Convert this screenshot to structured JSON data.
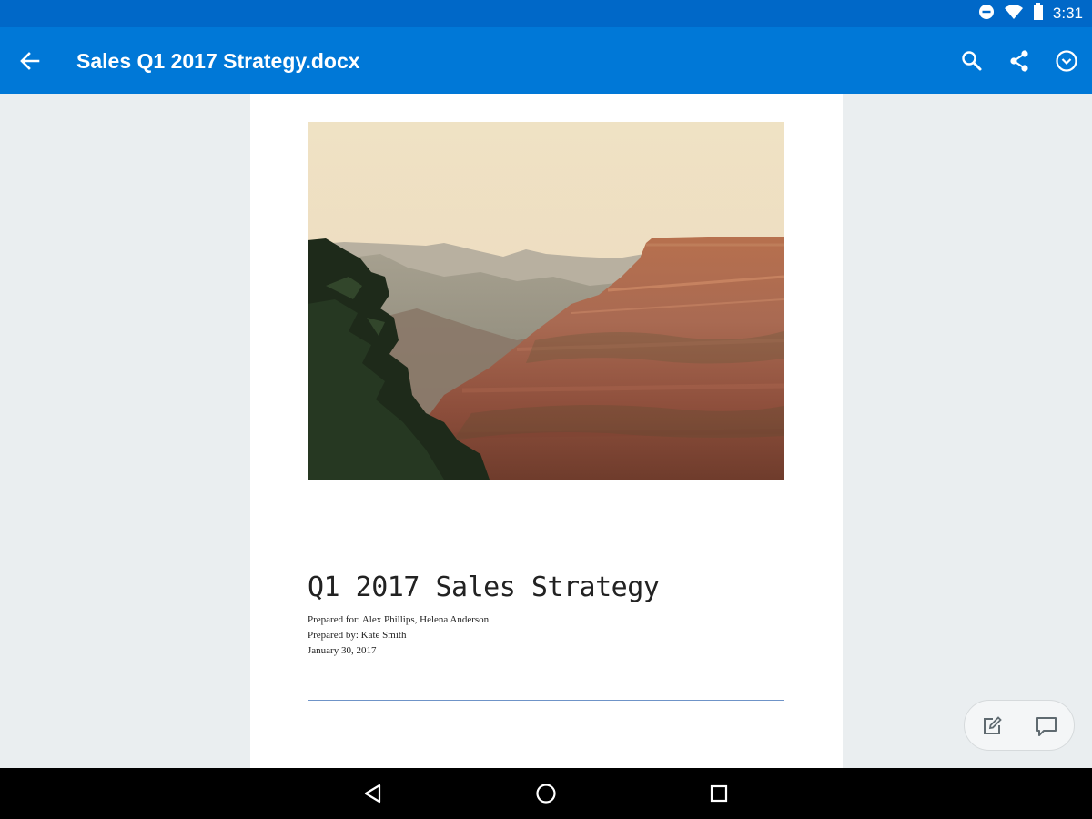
{
  "status_bar": {
    "time": "3:31",
    "icons": [
      "do-not-disturb-icon",
      "wifi-icon",
      "battery-icon"
    ]
  },
  "app_bar": {
    "title": "Sales Q1 2017 Strategy.docx",
    "back_icon": "arrow-back-icon",
    "actions": [
      "search-icon",
      "share-icon",
      "more-options-icon"
    ],
    "color": "#0078d7"
  },
  "document": {
    "heading": "Q1 2017 Sales Strategy",
    "prepared_for": "Prepared for: Alex Phillips, Helena Anderson",
    "prepared_by": "Prepared by: Kate Smith",
    "date": "January 30, 2017",
    "rule_color": "#6f94c8"
  },
  "floating_actions": [
    "edit-icon",
    "comment-icon"
  ],
  "nav_bar": [
    "back-triangle-icon",
    "home-circle-icon",
    "recents-square-icon"
  ]
}
